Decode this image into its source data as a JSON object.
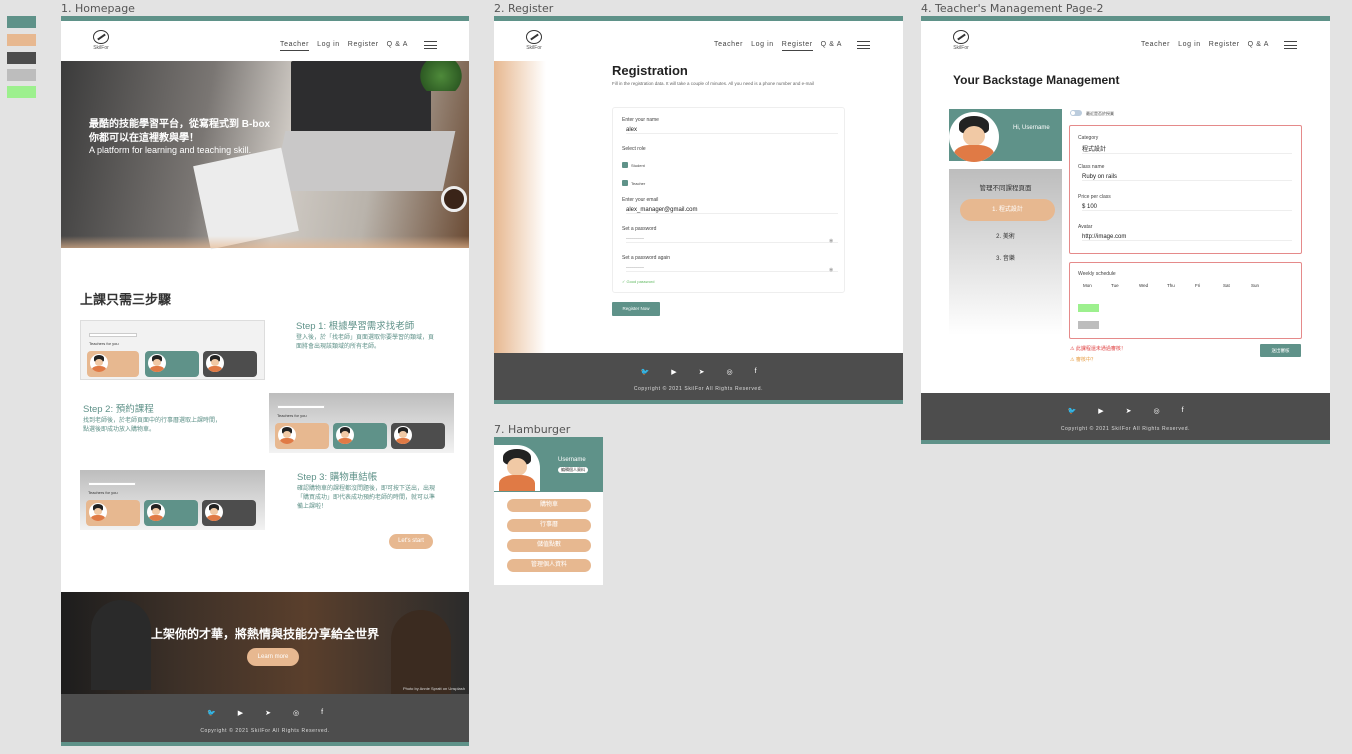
{
  "swatches": [
    "#5f9289",
    "#e7b890",
    "#4d4d4d",
    "#bdbdbd",
    "#9df08e"
  ],
  "frames": {
    "home": "1. Homepage",
    "register": "2. Register",
    "manage": "4. Teacher's Management Page-2",
    "hamburger": "7. Hamburger"
  },
  "nav": {
    "teacher": "Teacher",
    "login": "Log in",
    "register": "Register",
    "qa": "Q & A"
  },
  "logo_text": "SkilFor",
  "home": {
    "hero_line1": "最酷的技能學習平台，從寫程式到 B-box",
    "hero_line2": "你都可以在這裡教與學！",
    "hero_line3": "A platform for learning and teaching skill.",
    "steps_title": "上課只需三步驟",
    "step1_title": "Step 1: 根據學習需求找老師",
    "step1_desc": "登入後，於「找老師」頁面選取你要學習的類域，頁面將會出現該類域的所有老師。",
    "step2_title": "Step 2: 預約課程",
    "step2_desc": "找到老師後，於老師頁面中的行事曆選取上課時間，點選後即成功放入購物車。",
    "step3_title": "Step 3: 購物車結帳",
    "step3_desc": "確認購物車的課程都沒問題後，即可按下送出，出現「購買成功」即代表成功預約老師的時間，就可以準備上課啦！",
    "teachers_for_you": "Teachers for you",
    "lets_start": "Let's start",
    "banner_text": "上架你的才華，將熱情與技能分享給全世界",
    "learn_more": "Learn more",
    "photo_credit": "Photo by Annie Spratt on Unsplash",
    "copyright": "Copyright © 2021 SkilFor All Rights Reserved."
  },
  "register": {
    "title": "Registration",
    "subtitle": "Fill in the registration data. It will take a couple of minutes. All you need is a phone number and e-mail",
    "name_label": "Enter your name",
    "name_value": "alex",
    "role_label": "Select role",
    "role_student": "Student",
    "role_teacher": "Teacher",
    "email_label": "Enter your email",
    "email_value": "alex_manager@gmail.com",
    "password_label": "Set a password",
    "password_value": "·········",
    "password_again_label": "Set a password again",
    "password_again_value": "·········",
    "password_ok": "✓ Good password",
    "button": "Register Now",
    "copyright": "Copyright © 2021 SkilFor All Rights Reserved."
  },
  "manage": {
    "title": "Your Backstage Management",
    "hi_user": "Hi, Username",
    "toggle_label": "最近是否於授業",
    "menu_title": "管理不同課程頁面",
    "menu_item1": "1. 程式設計",
    "menu_item2": "2. 美術",
    "menu_item3": "3. 音樂",
    "category_label": "Category",
    "category_value": "程式設計",
    "classname_label": "Class name",
    "classname_value": "Ruby on rails",
    "price_label": "Price per class",
    "price_value": "$ 100",
    "avatar_label": "Avatar",
    "avatar_value": "http://image.com",
    "schedule_label": "Weekly schedule",
    "days": [
      "Mon",
      "Tue",
      "Wed",
      "Thu",
      "Fri",
      "Sat",
      "Sun"
    ],
    "error_msg": "此課程還未通過審核！",
    "warn_msg": "審核中？",
    "submit": "送出審核",
    "copyright": "Copyright © 2021 SkilFor All Rights Reserved."
  },
  "hamburger": {
    "username": "Username",
    "edit": "編輯個人資料",
    "items": [
      "購物車",
      "行事曆",
      "儲值點數",
      "管理個人資料"
    ]
  },
  "footer_icons": [
    "twitter-icon",
    "youtube-icon",
    "telegram-icon",
    "instagram-icon",
    "facebook-icon"
  ]
}
